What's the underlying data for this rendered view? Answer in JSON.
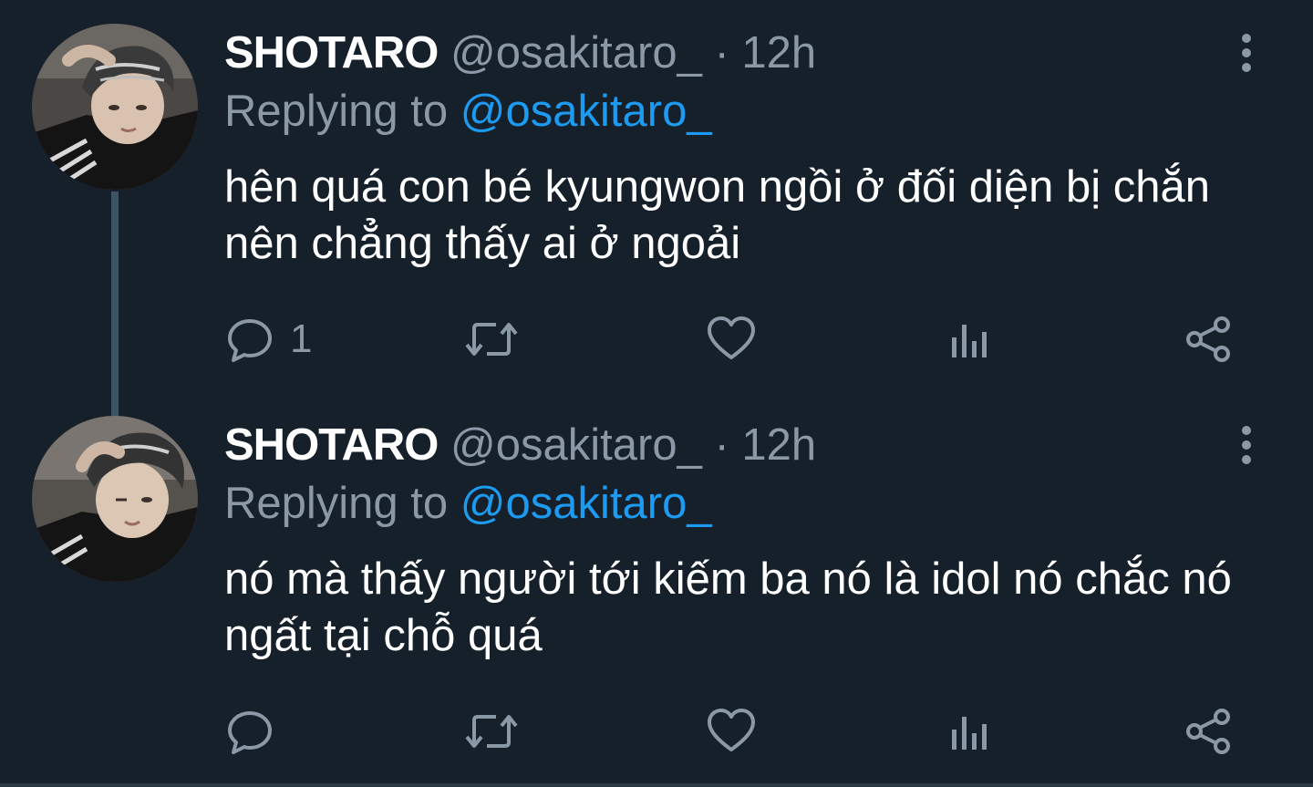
{
  "tweets": [
    {
      "display_name": "SHOTARO",
      "handle": "@osakitaro_",
      "separator": "·",
      "time": "12h",
      "replying_label": "Replying to",
      "replying_handle": "@osakitaro_",
      "text": "hên quá con bé kyungwon ngồi ở đối diện bị chắn nên chẳng thấy ai ở ngoải",
      "reply_count": "1"
    },
    {
      "display_name": "SHOTARO",
      "handle": "@osakitaro_",
      "separator": "·",
      "time": "12h",
      "replying_label": "Replying to",
      "replying_handle": "@osakitaro_",
      "text": "nó mà thấy người tới kiếm ba nó là idol nó chắc nó ngất tại chỗ quá",
      "reply_count": ""
    }
  ],
  "icons": {
    "reply": "reply-icon",
    "retweet": "retweet-icon",
    "like": "heart-icon",
    "analytics": "analytics-icon",
    "share": "share-icon",
    "more": "more-vertical-icon"
  },
  "colors": {
    "background": "#15202b",
    "text": "#ffffff",
    "muted": "#8b98a5",
    "link": "#1d9bf0",
    "thread_line": "#3d5466"
  }
}
